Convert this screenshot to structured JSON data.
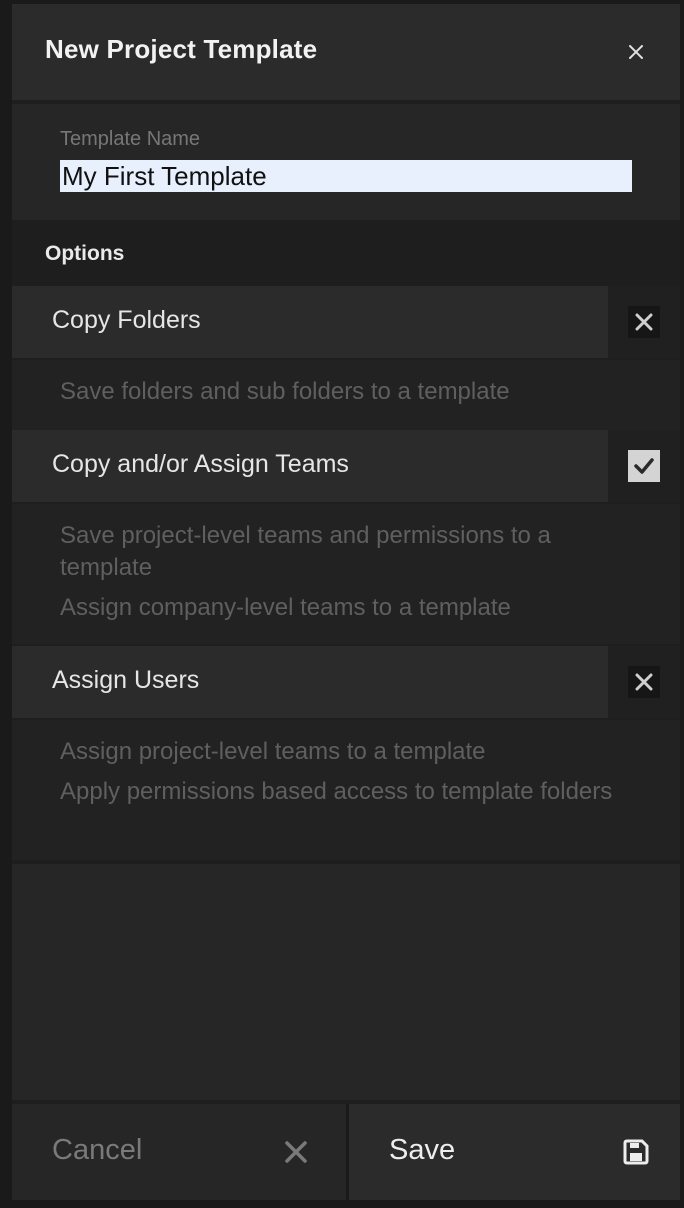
{
  "dialog": {
    "title": "New Project Template",
    "close_icon": "close-icon"
  },
  "template_name": {
    "label": "Template Name",
    "value": "My First Template"
  },
  "options": {
    "heading": "Options",
    "items": [
      {
        "label": "Copy Folders",
        "checked": false,
        "toggle_icon": "x-icon",
        "description": [
          "Save folders and sub folders to a template"
        ]
      },
      {
        "label": "Copy and/or Assign Teams",
        "checked": true,
        "toggle_icon": "checkmark-icon",
        "description": [
          "Save project-level teams and permissions to a template",
          "Assign company-level teams to a template"
        ]
      },
      {
        "label": "Assign Users",
        "checked": false,
        "toggle_icon": "x-icon",
        "description": [
          "Assign project-level teams to a template",
          "Apply permissions based access to template folders"
        ]
      }
    ]
  },
  "footer": {
    "cancel_label": "Cancel",
    "cancel_icon": "close-icon",
    "save_label": "Save",
    "save_icon": "floppy-disk-icon"
  },
  "colors": {
    "background": "#1a1a1a",
    "header": "#2b2b2b",
    "input_fill": "#e8f0fe",
    "checkbox_checked": "#d4d4d4",
    "description_text": "#5f5f5f"
  }
}
